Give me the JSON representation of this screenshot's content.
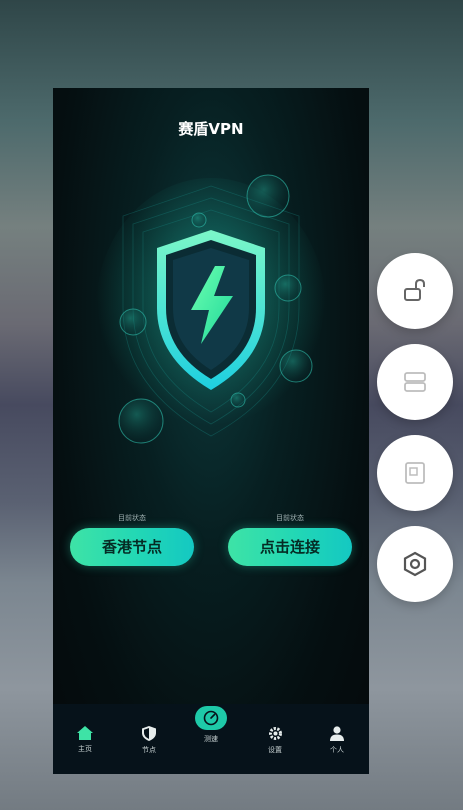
{
  "app": {
    "title": "赛盾VPN"
  },
  "status": {
    "left": {
      "label": "目前状态",
      "button": "香港节点"
    },
    "right": {
      "label": "目前状态",
      "button": "点击连接"
    }
  },
  "tabs": [
    {
      "label": "主页",
      "icon": "home-icon"
    },
    {
      "label": "节点",
      "icon": "shield-icon"
    },
    {
      "label": "测速",
      "icon": "speedometer-icon"
    },
    {
      "label": "设置",
      "icon": "gear-icon"
    },
    {
      "label": "个人",
      "icon": "person-icon"
    }
  ],
  "side_buttons": [
    {
      "icon": "unlock-icon"
    },
    {
      "icon": "split-screen-icon"
    },
    {
      "icon": "window-icon"
    },
    {
      "icon": "hexagon-settings-icon"
    }
  ],
  "colors": {
    "accent": "#22d7b5",
    "accent_green": "#3ee3a6",
    "background": "#05090b"
  }
}
